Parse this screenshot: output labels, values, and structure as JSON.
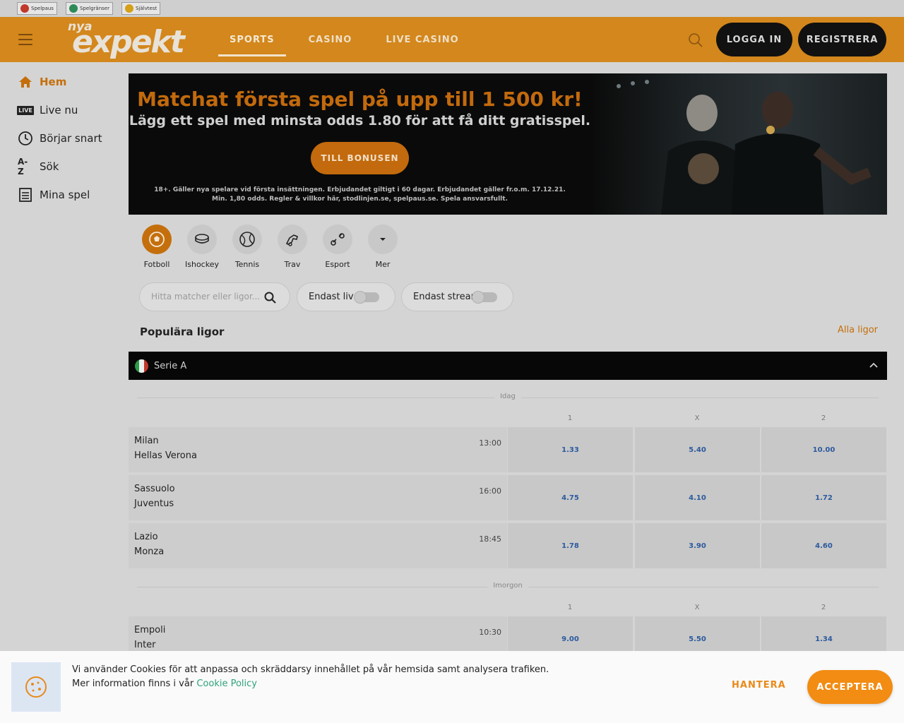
{
  "responsible_gaming": [
    {
      "label": "Spelpaus",
      "color": "#c0392b"
    },
    {
      "label": "Spelgränser",
      "color": "#2e8b57"
    },
    {
      "label": "Självtest",
      "color": "#d4a017"
    }
  ],
  "header": {
    "logo_small": "nya",
    "logo_main": "expekt",
    "nav": [
      {
        "label": "SPORTS",
        "active": true
      },
      {
        "label": "CASINO",
        "active": false
      },
      {
        "label": "LIVE CASINO",
        "active": false
      }
    ],
    "login_label": "LOGGA IN",
    "register_label": "REGISTRERA"
  },
  "sidebar": {
    "items": [
      {
        "label": "Hem",
        "icon": "home-icon",
        "active": true
      },
      {
        "label": "Live nu",
        "icon": "live-icon",
        "badge": "LIVE"
      },
      {
        "label": "Börjar snart",
        "icon": "clock-icon"
      },
      {
        "label": "Sök",
        "icon": "az-icon",
        "badge": "A-Z"
      },
      {
        "label": "Mina spel",
        "icon": "betslip-icon"
      }
    ]
  },
  "banner": {
    "title": "Matchat första spel på upp till 1 500 kr!",
    "subtitle": "Lägg ett spel med minsta odds 1.80 för att få ditt gratisspel.",
    "cta": "TILL BONUSEN",
    "terms_line1": "18+. Gäller nya spelare vid första insättningen. Erbjudandet giltigt i 60 dagar. Erbjudandet gäller fr.o.m. 17.12.21.",
    "terms_line2": "Min. 1,80 odds. Regler & villkor här, stodlinjen.se, spelpaus.se. Spela ansvarsfullt."
  },
  "sports": [
    {
      "label": "Fotboll",
      "icon": "football-icon",
      "active": true
    },
    {
      "label": "Ishockey",
      "icon": "hockey-puck-icon"
    },
    {
      "label": "Tennis",
      "icon": "tennis-ball-icon"
    },
    {
      "label": "Trav",
      "icon": "horse-icon"
    },
    {
      "label": "Esport",
      "icon": "gamepad-icon"
    },
    {
      "label": "Mer",
      "icon": "chevron-down-icon"
    }
  ],
  "filters": {
    "search_placeholder": "Hitta matcher eller ligor...",
    "live_only": "Endast live",
    "stream_only": "Endast stream"
  },
  "popular": {
    "title": "Populära ligor",
    "all_link": "Alla ligor"
  },
  "league": {
    "name": "Serie A",
    "flag_colors": [
      "#2a9d4a",
      "#eeeeee",
      "#c0392b"
    ]
  },
  "groups": [
    {
      "day": "Idag",
      "headers": [
        "1",
        "X",
        "2"
      ],
      "matches": [
        {
          "home": "Milan",
          "away": "Hellas Verona",
          "time": "13:00",
          "odds": [
            "1.33",
            "5.40",
            "10.00"
          ]
        },
        {
          "home": "Sassuolo",
          "away": "Juventus",
          "time": "16:00",
          "odds": [
            "4.75",
            "4.10",
            "1.72"
          ]
        },
        {
          "home": "Lazio",
          "away": "Monza",
          "time": "18:45",
          "odds": [
            "1.78",
            "3.90",
            "4.60"
          ]
        }
      ]
    },
    {
      "day": "Imorgon",
      "headers": [
        "1",
        "X",
        "2"
      ],
      "matches": [
        {
          "home": "Empoli",
          "away": "Inter",
          "time": "10:30",
          "odds": [
            "9.00",
            "5.50",
            "1.34"
          ]
        }
      ]
    }
  ],
  "cookie": {
    "line1": "Vi använder Cookies för att anpassa och skräddarsy innehållet på vår hemsida samt analysera trafiken.",
    "line2_prefix": "Mer information finns i vår",
    "policy_link": "Cookie Policy",
    "manage": "HANTERA",
    "accept": "ACCEPTERA"
  }
}
